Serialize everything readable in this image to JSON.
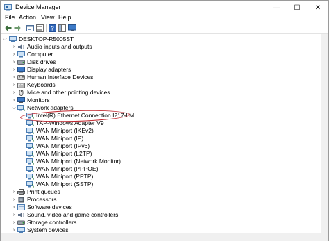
{
  "window": {
    "title": "Device Manager",
    "controls": {
      "minimize": "—",
      "maximize": "☐",
      "close": "✕"
    }
  },
  "menu": [
    "File",
    "Action",
    "View",
    "Help"
  ],
  "toolbar": [
    "back-arrow-icon",
    "forward-arrow-icon",
    "properties-icon",
    "list-view-icon",
    "help-icon",
    "panel-icon",
    "monitor-icon"
  ],
  "tree": {
    "root": "DESKTOP-R5005ST",
    "categories_before": [
      "Audio inputs and outputs",
      "Computer",
      "Disk drives",
      "Display adapters",
      "Human Interface Devices",
      "Keyboards",
      "Mice and other pointing devices",
      "Monitors"
    ],
    "network": {
      "label": "Network adapters",
      "children": [
        "Intel(R) Ethernet Connection I217-LM",
        "TAP-Windows Adapter V9",
        "WAN Miniport (IKEv2)",
        "WAN Miniport (IP)",
        "WAN Miniport (IPv6)",
        "WAN Miniport (L2TP)",
        "WAN Miniport (Network Monitor)",
        "WAN Miniport (PPPOE)",
        "WAN Miniport (PPTP)",
        "WAN Miniport (SSTP)"
      ]
    },
    "categories_after": [
      "Print queues",
      "Processors",
      "Software devices",
      "Sound, video and game controllers",
      "Storage controllers",
      "System devices"
    ]
  },
  "colors": {
    "highlight_ellipse": "#c0262d",
    "selection": "#cce8ff"
  }
}
